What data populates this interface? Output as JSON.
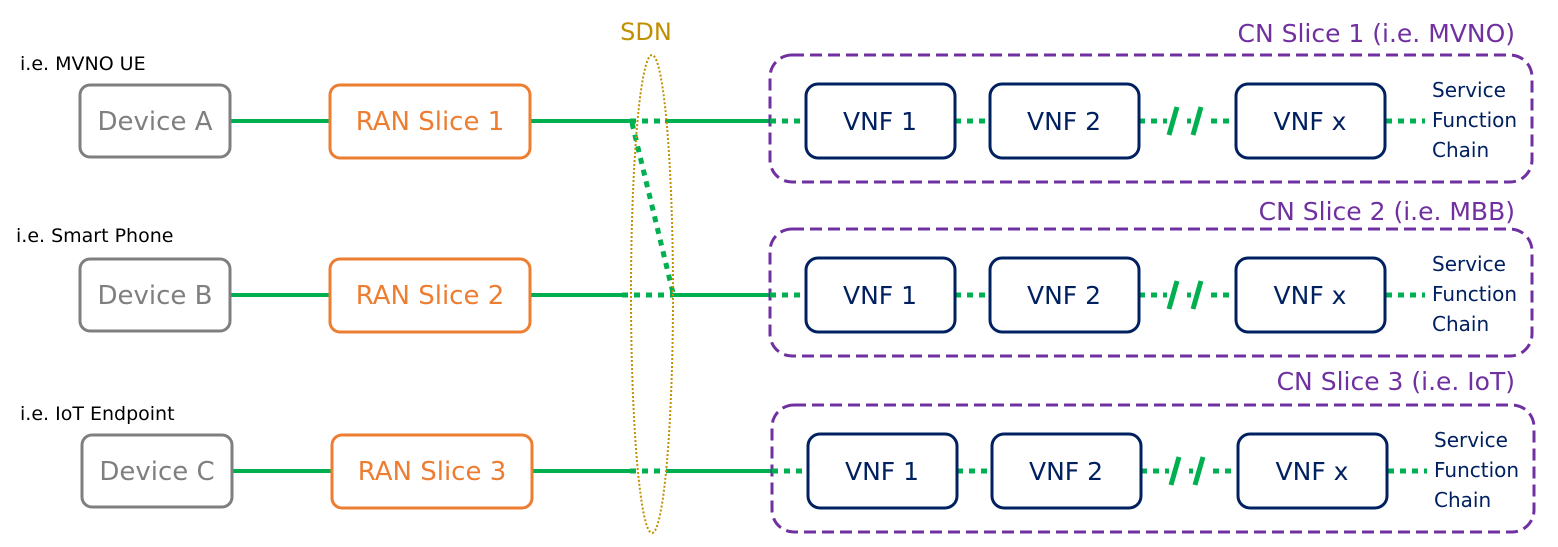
{
  "sdn": {
    "label": "SDN",
    "color": "#c09000"
  },
  "colors": {
    "device": "#7f7f7f",
    "ran": "#ed7d31",
    "link": "#00b050",
    "vnf": "#002060",
    "cn": "#7030a0"
  },
  "rows": [
    {
      "device_caption": "i.e. MVNO UE",
      "device": "Device A",
      "ran": "RAN Slice 1",
      "cn_title": "CN Slice 1 (i.e. MVNO)",
      "vnfs": [
        "VNF 1",
        "VNF 2",
        "VNF x"
      ],
      "sfc": [
        "Service",
        "Function",
        "Chain"
      ]
    },
    {
      "device_caption": "i.e. Smart Phone",
      "device": "Device B",
      "ran": "RAN Slice 2",
      "cn_title": "CN Slice 2 (i.e. MBB)",
      "vnfs": [
        "VNF 1",
        "VNF 2",
        "VNF x"
      ],
      "sfc": [
        "Service",
        "Function",
        "Chain"
      ]
    },
    {
      "device_caption": "i.e. IoT Endpoint",
      "device": "Device C",
      "ran": "RAN Slice 3",
      "cn_title": "CN Slice 3 (i.e. IoT)",
      "vnfs": [
        "VNF 1",
        "VNF 2",
        "VNF x"
      ],
      "sfc": [
        "Service",
        "Function",
        "Chain"
      ]
    }
  ]
}
